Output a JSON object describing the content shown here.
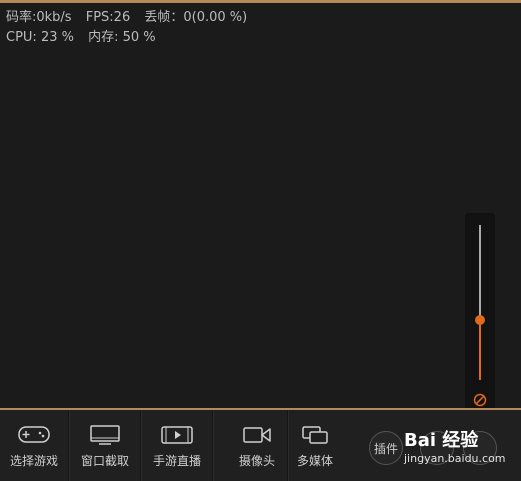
{
  "stats": {
    "bitrate": "码率:0kb/s",
    "fps": "FPS:26",
    "dropped": "丢帧：0(0.00 %)",
    "cpu": "CPU: 23 %",
    "memory": "内存: 50 %"
  },
  "volume": {
    "level": 0.39,
    "accent": "#e0691c"
  },
  "toolbar": {
    "items": [
      {
        "label": "选择游戏",
        "icon": "gamepad-icon"
      },
      {
        "label": "窗口截取",
        "icon": "monitor-icon"
      },
      {
        "label": "手游直播",
        "icon": "phone-play-icon"
      },
      {
        "label": "摄像头",
        "icon": "camera-icon"
      },
      {
        "label": "多媒体",
        "icon": "media-icon"
      }
    ],
    "plugin_label": "插件"
  },
  "watermark": {
    "logo": "Bai 经验",
    "url": "jingyan.baidu.com"
  }
}
